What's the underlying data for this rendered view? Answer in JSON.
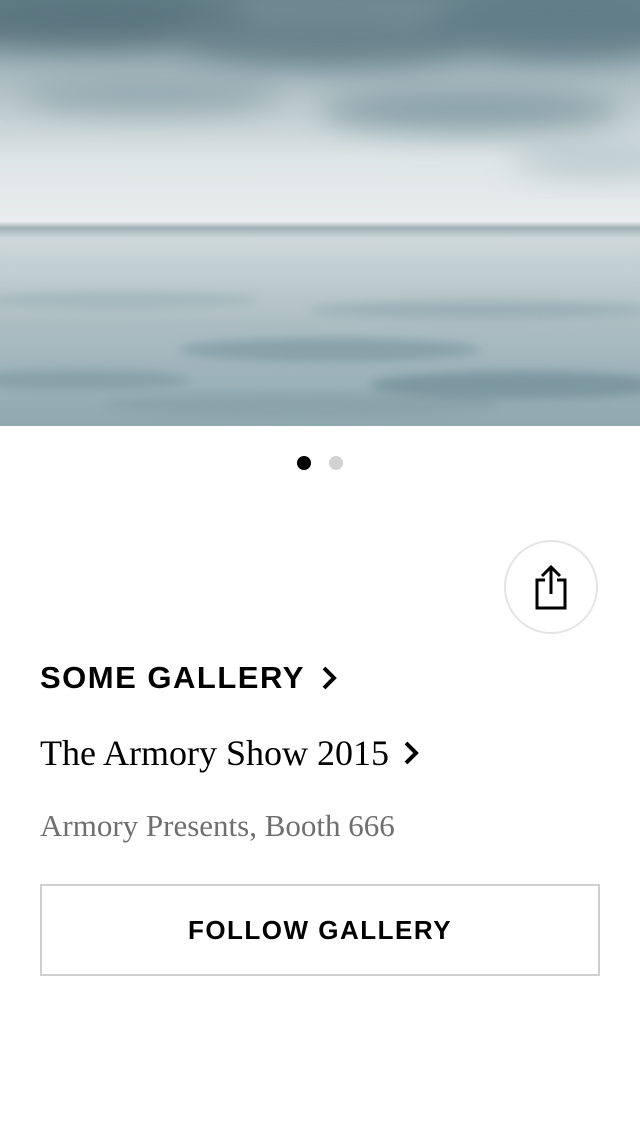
{
  "artwork": {
    "image_icon": "seascape-artwork-image",
    "pager": {
      "count": 2,
      "active_index": 0
    }
  },
  "share": {
    "icon": "share-icon"
  },
  "gallery": {
    "name": "SOME GALLERY",
    "chevron_icon": "chevron-right-icon"
  },
  "fair": {
    "name": "The Armory Show 2015",
    "chevron_icon": "chevron-right-icon"
  },
  "location": {
    "text": "Armory Presents, Booth 666"
  },
  "follow": {
    "label": "FOLLOW GALLERY"
  },
  "colors": {
    "accent": "#000000",
    "muted_text": "#6f6f6f",
    "border": "#cfcfcf",
    "dot_inactive": "#d2d2d2"
  }
}
